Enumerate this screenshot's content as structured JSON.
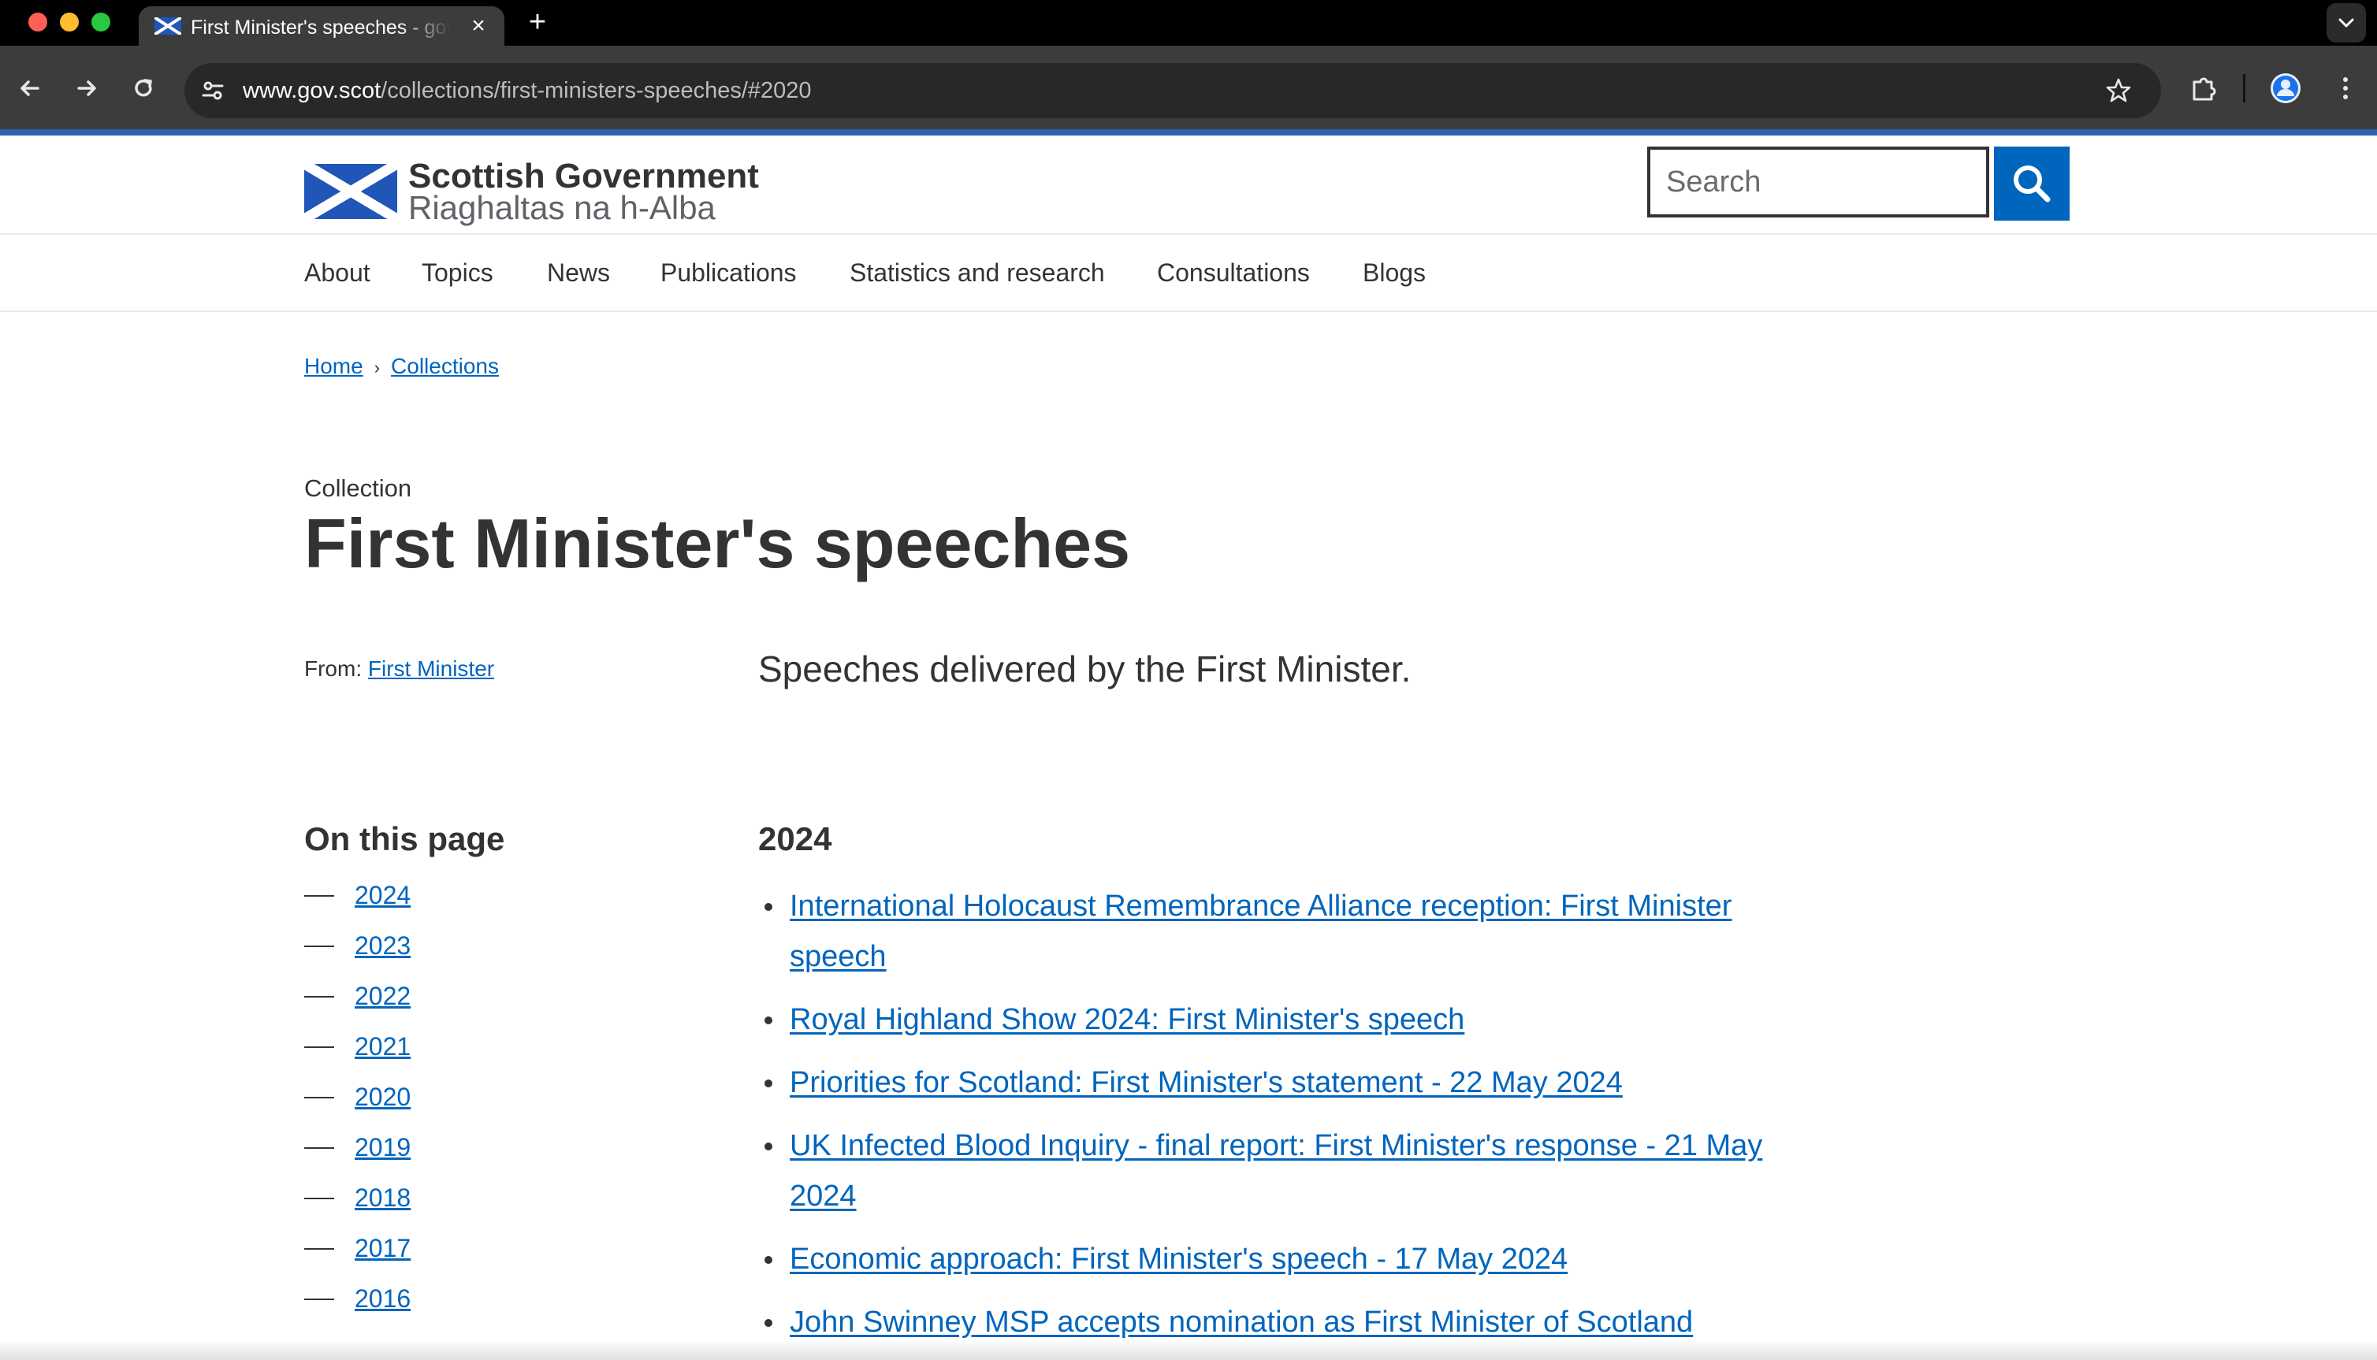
{
  "browser": {
    "tab_title": "First Minister's speeches - gov.scot",
    "url_host": "www.gov.scot",
    "url_path": "/collections/first-ministers-speeches/#2020"
  },
  "site": {
    "logo_english": "Scottish Government",
    "logo_gaelic": "Riaghaltas na h-Alba",
    "search_placeholder": "Search",
    "accent_color": "#0065bd"
  },
  "nav": {
    "items": [
      "About",
      "Topics",
      "News",
      "Publications",
      "Statistics and research",
      "Consultations",
      "Blogs"
    ]
  },
  "breadcrumb": {
    "items": [
      "Home",
      "Collections"
    ],
    "separator": "›"
  },
  "page": {
    "kicker": "Collection",
    "title": "First Minister's speeches",
    "from_label": "From:",
    "from_link": "First Minister",
    "summary": "Speeches delivered by the First Minister."
  },
  "on_this_page": {
    "title": "On this page",
    "years": [
      "2024",
      "2023",
      "2022",
      "2021",
      "2020",
      "2019",
      "2018",
      "2017",
      "2016"
    ]
  },
  "section": {
    "year": "2024",
    "speeches": [
      "International Holocaust Remembrance Alliance reception: First Minister speech",
      "Royal Highland Show 2024: First Minister's speech",
      "Priorities for Scotland: First Minister's statement - 22 May 2024",
      "UK Infected Blood Inquiry - final report: First Minister's response - 21 May 2024",
      "Economic approach: First Minister's speech - 17 May 2024",
      "John Swinney MSP accepts nomination as First Minister of Scotland"
    ]
  }
}
